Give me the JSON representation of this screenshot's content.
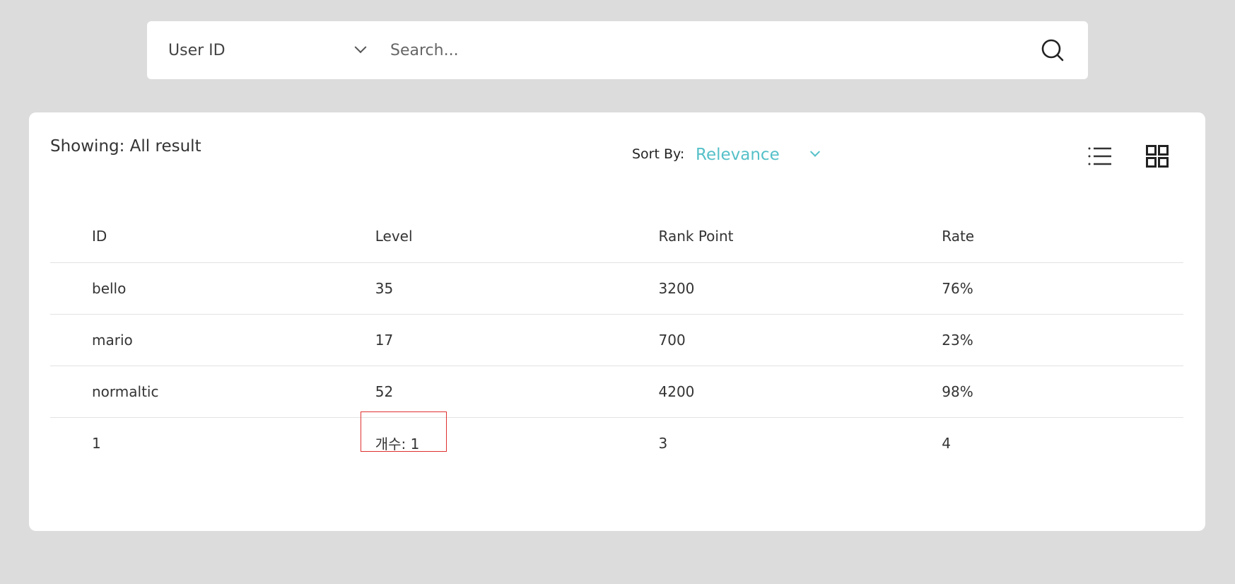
{
  "search": {
    "field_select": "User ID",
    "placeholder": "Search..."
  },
  "panel": {
    "showing_text": "Showing: All result",
    "sort_label": "Sort By:",
    "sort_value": "Relevance",
    "accent_color": "#55c0c8"
  },
  "table": {
    "headers": [
      "ID",
      "Level",
      "Rank Point",
      "Rate"
    ],
    "rows": [
      [
        "bello",
        "35",
        "3200",
        "76%"
      ],
      [
        "mario",
        "17",
        "700",
        "23%"
      ],
      [
        "normaltic",
        "52",
        "4200",
        "98%"
      ]
    ],
    "total_row": [
      "1",
      "개수: 1",
      "3",
      "4"
    ],
    "highlight_color": "#e03030"
  }
}
